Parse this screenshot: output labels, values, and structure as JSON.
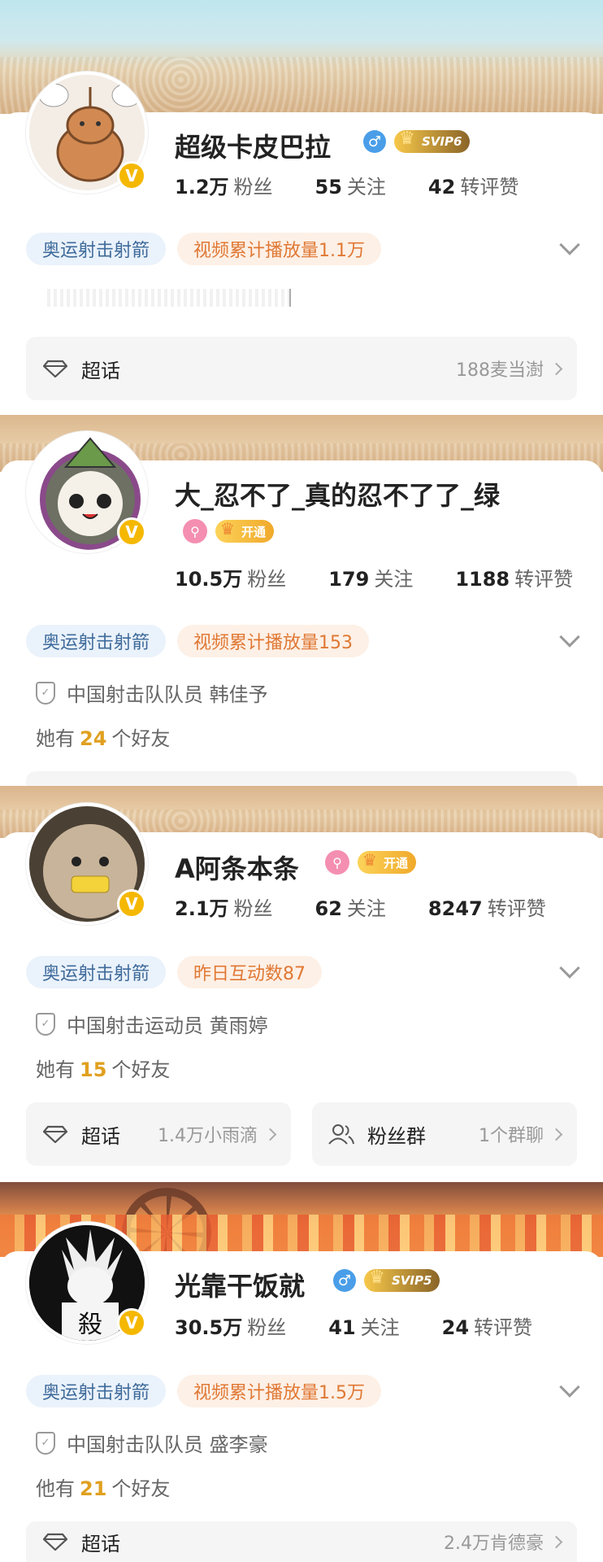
{
  "cards": [
    {
      "name": "超级卡皮巴拉",
      "gender": "♂",
      "vip": "SVIP6",
      "stats": [
        {
          "num": "1.2万",
          "label": "粉丝"
        },
        {
          "num": "55",
          "label": "关注"
        },
        {
          "num": "42",
          "label": "转评赞"
        }
      ],
      "tags": [
        "奥运射击射箭",
        "视频累计播放量1.1万"
      ],
      "panel": {
        "title": "超话",
        "value": "188麦当澍"
      }
    },
    {
      "name": "大_忍不了_真的忍不了了_绿",
      "open_label": "开通",
      "stats": [
        {
          "num": "10.5万",
          "label": "粉丝"
        },
        {
          "num": "179",
          "label": "关注"
        },
        {
          "num": "1188",
          "label": "转评赞"
        }
      ],
      "tags": [
        "奥运射击射箭",
        "视频累计播放量153"
      ],
      "identity": "中国射击队队员 韩佳予",
      "friends": {
        "prefix": "她有",
        "count": "24",
        "suffix": "个好友"
      }
    },
    {
      "name": "A阿条本条",
      "open_label": "开通",
      "stats": [
        {
          "num": "2.1万",
          "label": "粉丝"
        },
        {
          "num": "62",
          "label": "关注"
        },
        {
          "num": "8247",
          "label": "转评赞"
        }
      ],
      "tags": [
        "奥运射击射箭",
        "昨日互动数87"
      ],
      "identity": "中国射击运动员 黄雨婷",
      "friends": {
        "prefix": "她有",
        "count": "15",
        "suffix": "个好友"
      },
      "panel": {
        "title": "超话",
        "value": "1.4万小雨滴"
      },
      "panel2": {
        "title": "粉丝群",
        "value": "1个群聊"
      }
    },
    {
      "name": "光靠干饭就",
      "gender": "♂",
      "vip": "SVIP5",
      "stats": [
        {
          "num": "30.5万",
          "label": "粉丝"
        },
        {
          "num": "41",
          "label": "关注"
        },
        {
          "num": "24",
          "label": "转评赞"
        }
      ],
      "tags": [
        "奥运射击射箭",
        "视频累计播放量1.5万"
      ],
      "identity": "中国射击队队员 盛李豪",
      "friends": {
        "prefix": "他有",
        "count": "21",
        "suffix": "个好友"
      },
      "panel": {
        "title": "超话",
        "value": "2.4万肯德豪"
      }
    }
  ],
  "avatar_glyph": "殺",
  "colors": {
    "verified": "#f5b800",
    "tag_blue": "#3e6a9a",
    "tag_orange": "#e07834",
    "friend_count": "#e0a020"
  }
}
